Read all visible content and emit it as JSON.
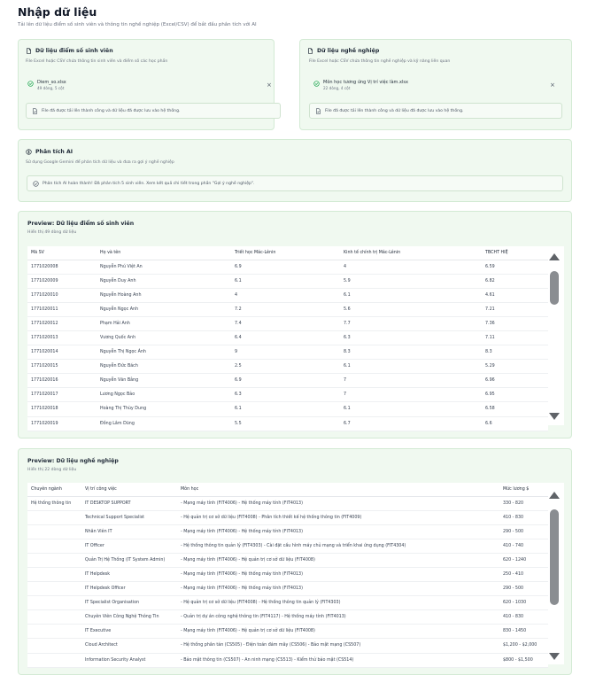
{
  "page": {
    "title": "Nhập dữ liệu",
    "subtitle": "Tải lên dữ liệu điểm số sinh viên và thông tin nghề nghiệp (Excel/CSV) để bắt đầu phân tích với AI"
  },
  "colors": {
    "card_bg": "#f0f9f0",
    "card_border": "#d3ead4",
    "accent_green": "#16a34a",
    "scroll_thumb": "#8a8d91"
  },
  "upload_student": {
    "icon": "file-icon",
    "title": "Dữ liệu điểm số sinh viên",
    "desc": "File Excel hoặc CSV chứa thông tin sinh viên và điểm số các học phần",
    "file_name": "Diem_so.xlsx",
    "file_meta": "49 dòng, 5 cột",
    "remove_label": "×",
    "notice": "File đã được tải lên thành công và dữ liệu đã được lưu vào hệ thống."
  },
  "upload_career": {
    "icon": "file-icon",
    "title": "Dữ liệu nghề nghiệp",
    "desc": "File Excel hoặc CSV chứa thông tin nghề nghiệp và kỹ năng liên quan",
    "file_name": "Môn học tương ứng Vị trí việc làm.xlsx",
    "file_meta": "22 dòng, 4 cột",
    "remove_label": "×",
    "notice": "File đã được tải lên thành công và dữ liệu đã được lưu vào hệ thống."
  },
  "ai": {
    "title": "Phân tích AI",
    "desc": "Sử dụng Google Gemini để phân tích dữ liệu và đưa ra gợi ý nghề nghiệp",
    "notice": "Phân tích AI hoàn thành! Đã phân tích 5 sinh viên. Xem kết quả chi tiết trong phần \"Gợi ý nghề nghiệp\"."
  },
  "students": {
    "title": "Preview: Dữ liệu điểm số sinh viên",
    "subtitle": "Hiển thị 49 dòng dữ liệu",
    "columns": [
      "Mã SV",
      "Họ và tên",
      "Triết học Mác-Lênin",
      "Kinh tế chính trị Mác-Lênin",
      "TBCHT HIỆ"
    ],
    "rows": [
      [
        "1771020008",
        "Nguyễn Phú Việt An",
        "6.9",
        "4",
        "6.59"
      ],
      [
        "1771020009",
        "Nguyễn Duy Anh",
        "6.1",
        "5.9",
        "6.82"
      ],
      [
        "1771020010",
        "Nguyễn Hoàng Anh",
        "4",
        "6.1",
        "4.61"
      ],
      [
        "1771020011",
        "Nguyễn Ngọc Anh",
        "7.2",
        "5.6",
        "7.21"
      ],
      [
        "1771020012",
        "Phạm Hải Anh",
        "7.4",
        "7.7",
        "7.36"
      ],
      [
        "1771020013",
        "Vương Quốc Anh",
        "6.4",
        "6.3",
        "7.11"
      ],
      [
        "1771020014",
        "Nguyễn Thị Ngọc Ánh",
        "9",
        "8.3",
        "8.3"
      ],
      [
        "1771020015",
        "Nguyễn Đức Bách",
        "2.5",
        "6.1",
        "5.29"
      ],
      [
        "1771020016",
        "Nguyễn Văn Bằng",
        "6.9",
        "7",
        "6.96"
      ],
      [
        "1771020017",
        "Lương Ngọc Bảo",
        "6.3",
        "7",
        "6.95"
      ],
      [
        "1771020018",
        "Hoàng Thị Thùy Dung",
        "6.1",
        "6.1",
        "6.58"
      ],
      [
        "1771020019",
        "Đồng Lâm Dũng",
        "5.5",
        "6.7",
        "6.6"
      ]
    ]
  },
  "careers": {
    "title": "Preview: Dữ liệu nghề nghiệp",
    "subtitle": "Hiển thị 22 dòng dữ liệu",
    "columns": [
      "Chuyên ngành",
      "Vị trí công việc",
      "Môn học",
      "Mức lương $"
    ],
    "rows": [
      [
        "Hệ thống thông tin",
        "IT DESKTOP SUPPORT",
        "- Mạng máy tính (FIT4006) - Hệ thống máy tính (FIT4013)",
        "330 - 820"
      ],
      [
        "",
        "Technical Support Specialist",
        "- Hệ quản trị cơ sở dữ liệu (FIT4008) - Phân tích thiết kế hệ thống thông tin (FIT4009)",
        "410 - 830"
      ],
      [
        "",
        "Nhân Viên IT",
        "- Mạng máy tính (FIT4006) - Hệ thống máy tính (FIT4013)",
        "290 - 500"
      ],
      [
        "",
        "IT Officer",
        "- Hệ thống thông tin quản lý (FIT4303) - Cài đặt cấu hình máy chủ mạng và triển khai ứng dụng (FIT4304)",
        "410 - 740"
      ],
      [
        "",
        "Quản Trị Hệ Thống (IT System Admin)",
        "- Mạng máy tính (FIT4006) - Hệ quản trị cơ sở dữ liệu (FIT4008)",
        "620 - 1240"
      ],
      [
        "",
        "IT Helpdesk",
        "- Mạng máy tính (FIT4006) - Hệ thống máy tính (FIT4013)",
        "250 - 410"
      ],
      [
        "",
        "IT Helpdesk Officer",
        "- Mạng máy tính (FIT4006) - Hệ thống máy tính (FIT4013)",
        "290 - 500"
      ],
      [
        "",
        "IT Specialist Organisation",
        "- Hệ quản trị cơ sở dữ liệu (FIT4008) - Hệ thống thông tin quản lý (FIT4303)",
        "620 - 1030"
      ],
      [
        "",
        "Chuyên Viên Công Nghệ Thông Tin",
        "- Quản trị dự án công nghệ thông tin (FIT4117) - Hệ thống máy tính (FIT4013)",
        "410 - 830"
      ],
      [
        "",
        "IT Executive",
        "- Mạng máy tính (FIT4006) - Hệ quản trị cơ sở dữ liệu (FIT4008)",
        "830 - 1450"
      ],
      [
        "",
        "Cloud Architect",
        "- Hệ thống phân tán (CS505) - Điện toán đám mây (CS506) - Bảo mật mạng (CS507)",
        "$1,200 - $2,000"
      ],
      [
        "",
        "Information Security Analyst",
        "- Bảo mật thông tin (CS507) - An ninh mạng (CS513) - Kiểm thử bảo mật (CS514)",
        "$800 - $1,500"
      ]
    ]
  }
}
